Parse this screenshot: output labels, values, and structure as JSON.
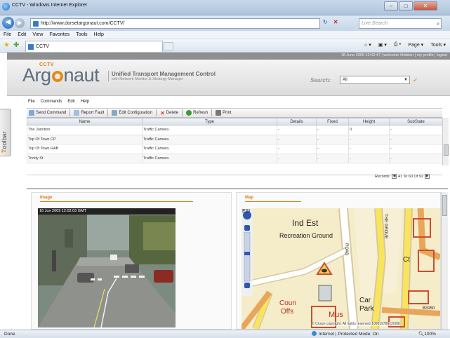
{
  "browser": {
    "window_title": "CCTV - Windows Internet Explorer",
    "url": "http://www.dorsetargonaut.com/CCTV/",
    "live_search_placeholder": "Live Search",
    "menu": [
      "File",
      "Edit",
      "View",
      "Favorites",
      "Tools",
      "Help"
    ],
    "tab_title": "CCTV",
    "command_bar": [
      "Page ▾",
      "Tools ▾"
    ],
    "status_left": "Done",
    "status_zone": "Internet | Protected Mode: On",
    "status_zoom": "100%"
  },
  "app": {
    "user_info": "18 June 2009 12:02:47 | welcome #hidden | my profile | logout",
    "logo_cctv": "CCTV",
    "logo_text": [
      "Arg",
      "naut"
    ],
    "tagline_main": "Unified Transport Management Control",
    "tagline_sub": "with Network Monitor & Strategy Manager",
    "search_label": "Search:",
    "search_value": "All",
    "toolbar_tab": [
      "T",
      "oolbar"
    ],
    "menus": [
      "File",
      "Commands",
      "Edit",
      "Help"
    ],
    "actions": [
      {
        "label": "Send Command",
        "color": "#7fa9d8"
      },
      {
        "label": "Report Fault",
        "color": "#9fbfe0"
      },
      {
        "label": "Edit Configuration",
        "color": "#8aa7c8"
      },
      {
        "label": "Delete",
        "color": "#d33"
      },
      {
        "label": "Refresh",
        "color": "#3a9a3a"
      },
      {
        "label": "Print",
        "color": "#777"
      }
    ],
    "grid": {
      "columns": [
        "Name",
        "Type",
        "Details",
        "Fixed",
        "Height",
        "SubState"
      ],
      "rows": [
        [
          "The Junction",
          "Traffic Camera",
          "-",
          "-",
          "0",
          "-"
        ],
        [
          "Top Of Town CP",
          "Traffic Camera",
          "-",
          "-",
          "-",
          "-"
        ],
        [
          "Top Of Town RAB",
          "Traffic Camera",
          "-",
          "-",
          "-",
          "-"
        ],
        [
          "Trinity St",
          "Traffic Camera",
          "-",
          "-",
          "-",
          "-"
        ]
      ],
      "records_label": "Records:",
      "records_range": "41 To 60 Of 92"
    },
    "image_panel": {
      "title": "Image",
      "timestamp": "16 Jun 2009 12:02:03 GMT"
    },
    "map_panel": {
      "title": "Map",
      "labels": [
        "Ind Est",
        "Recreation Ground",
        "Coun",
        "Offs",
        "Mus",
        "Car",
        "Park",
        "Ct",
        "ROAD",
        "THE GROVE",
        "ESt",
        "B3150"
      ],
      "copyright": "© Crown copyright. All rights reserved 100019786 (2009)"
    }
  }
}
